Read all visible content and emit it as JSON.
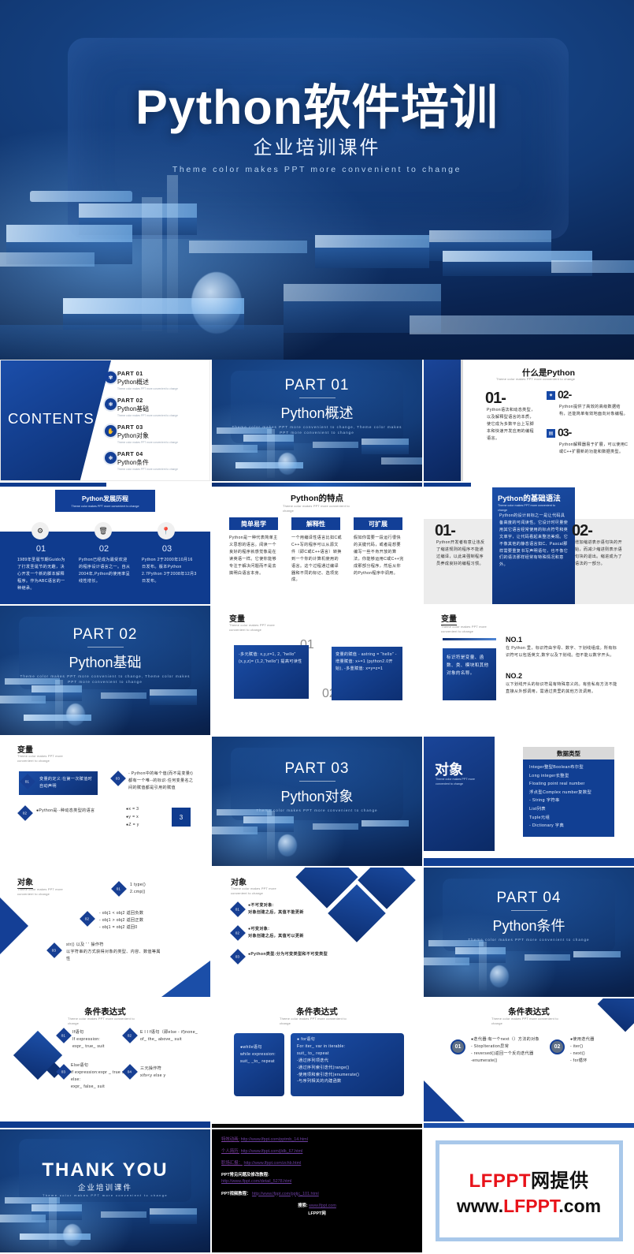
{
  "hero": {
    "title": "Python软件培训",
    "subtitle": "企业培训课件",
    "tagline": "Theme color makes PPT more convenient to change"
  },
  "contents": {
    "heading": "CONTENTS",
    "items": [
      {
        "num": "01",
        "part": "PART 01",
        "name": "Python概述",
        "tag": "Theme color makes PPT more convenient to change",
        "icon": "atom-icon"
      },
      {
        "num": "02",
        "part": "PART 02",
        "name": "Python基础",
        "tag": "Theme color makes PPT more convenient to change",
        "icon": "gear-icon"
      },
      {
        "num": "03",
        "part": "PART 03",
        "name": "Python对象",
        "tag": "Theme color makes PPT more convenient to change",
        "icon": "hand-icon"
      },
      {
        "num": "04",
        "part": "PART 04",
        "name": "Python条件",
        "tag": "Theme color makes PPT more convenient to change",
        "icon": "globe-icon"
      }
    ]
  },
  "sections": [
    {
      "part": "PART 01",
      "name": "Python概述",
      "tag": "Theme color makes PPT more convenient to change, Theme color makes PPT more convenient to change"
    },
    {
      "part": "PART 02",
      "name": "Python基础",
      "tag": "Theme color makes PPT more convenient to change, Theme color makes PPT more convenient to change"
    },
    {
      "part": "PART 03",
      "name": "Python对象",
      "tag": "Theme color makes PPT more convenient to change"
    },
    {
      "part": "PART 04",
      "name": "Python条件",
      "tag": "Theme color makes PPT more convenient to change"
    }
  ],
  "what_is_python": {
    "title": "什么是Python",
    "subtitle": "Theme color makes PPT more convenient to change",
    "items": [
      {
        "num": "01-",
        "text": "Python语法和动态类型，以及解释型语言的本质，使它成为多数平台上写脚本和快速开发应用的编程语言。"
      },
      {
        "num": "02-",
        "text": "Python提供了高效的高级数据结构，还能简单有效地面向对象编程。",
        "icon": "gear-icon"
      },
      {
        "num": "03-",
        "text": "Python解释器易于扩展，可以使用C或C++扩展新的功能和数据类型。",
        "icon": "book-icon"
      }
    ]
  },
  "history": {
    "title": "Python发展历程",
    "subtitle": "Theme color makes PPT more convenient to change",
    "items": [
      {
        "num": "01",
        "icon": "gear-icon",
        "text": "1989年圣诞节期Guido为了打发圣诞节的无趣，决心开发一个新的脚本解释程序。作为ABC语言的一种继承。"
      },
      {
        "num": "02",
        "icon": "trash-icon",
        "text": "Python已经成为最受欢迎的程序设计语言之一。自从2004年,Python的使用率呈线性增长。"
      },
      {
        "num": "03",
        "icon": "pin-icon",
        "text": "Python 2于2000年10月16日发布。版本Python 2.7Python 3于2008年12月3日发布。"
      }
    ]
  },
  "features": {
    "title": "Python的特点",
    "subtitle": "Theme color makes PPT more convenient to change",
    "cards": [
      {
        "head": "简单易学",
        "text": "Python是一种代表简单主义思想的语言。阅读一个良好的程序就感觉像是在读英语一样。它使你能够专注于解决问题而不是去搞明白语言本身。"
      },
      {
        "head": "解释性",
        "text": "一个用编译性语言比如C或C++写的程序可以从源文件（即C或C++语言）转换到一个你的计算机使用的语言。这个过程通过编译器和不同的标记、选项完成。"
      },
      {
        "head": "可扩展",
        "text": "假如你需要一段运行很快的关键代码，或者是想要编写一些不肯开放的算法，你能够运用C或C++完成那部分程序，然后从你的Python程序中调用。"
      }
    ]
  },
  "syntax": {
    "title": "Python的基础语法",
    "subtitle": "Theme color makes PPT more convenient to change",
    "center_text": "Python的设计目标之一是让代码具备高度的可阅读性。它设计时尽量使用其它语言经常使用的标点符号和英文单字，让代码看起来整洁美观。它不像其他的静态语言如C、Pascal那样需要重复书写声明语句，也不像它们的语法那样经常有特殊情况和意外。",
    "left": {
      "num": "01-",
      "text": "Python开发者有意让违反了缩进规则的程序不能通过编译，以此来强制程序员养成良好的编程习惯。"
    },
    "right": {
      "num": "02-",
      "text": "增加缩进表示语句块的开始，而减少缩进则表示语句块的退出。缩进成为了语法的一部分。"
    }
  },
  "variables_1": {
    "title": "变量",
    "subtitle": "Theme color makes PPT more convenient to change",
    "num1": "01",
    "num2": "02",
    "box1": "-多元赋值: x,y,z=1, 2, “hello” (x,y,z)= (1,2,“hello”) 提高可读性",
    "box2": "变量的赋值 - astring = “hello” -增量赋值: x+=1 (python2.0开始), -多重赋值: x=y=z=1"
  },
  "variables_2": {
    "title": "变量",
    "subtitle": "Theme color makes PPT more convenient to change",
    "sidebox": "标识符是变量、函数、类、模块和其他对象的名称。",
    "items": [
      {
        "head": "NO.1",
        "text": "在 Python 里，标识符由字母、数字、下划线组成。所有标识符可以包括英文,数字以及下划线。但不能以数字开头。"
      },
      {
        "head": "NO.2",
        "text": "以下划线开头的标识符是有特殊意义的。有些私有方法不能直接从外部调用，需通过类里的其他方法调用。"
      }
    ]
  },
  "variables_3": {
    "title": "变量",
    "subtitle": "Theme color makes PPT more convenient to change",
    "box1": "变量的定义:在第一次赋值时自动声明",
    "bullets": [
      {
        "num": "01",
        "text": "变量的定义:在第一次赋值时自动声明"
      },
      {
        "num": "02",
        "text": "●Python是·-种动态类型的语言"
      },
      {
        "num": "03",
        "text": "- Python中的每个值(而不是变量t)都有一个唯--的标识·任何变量名之间的赋值都是引用的赋值"
      }
    ],
    "eqs": [
      "●x = 3",
      "●y = x",
      "●Z = y"
    ],
    "result": "3"
  },
  "object_intro": {
    "title": "对象",
    "subtitle": "Theme color makes PPT more convenient to change",
    "table_head": "数据类型",
    "rows": [
      "Integer整型Boolean布尔型",
      "Long integer长整型",
      "Floating point real number",
      "浮点型Complex number复数型",
      "- String 字符串",
      "List列表",
      "Tuple元组",
      "- Dictionary 字典"
    ]
  },
  "object_1": {
    "title": "对象",
    "subtitle": "Theme color makes PPT more convenient to change",
    "items": [
      {
        "num": "01",
        "text": "1 type()\n2.cmp()"
      },
      {
        "num": "02",
        "text": "- obj1 < obj2 返回负数\n- obj1 > obj2 返回正数\n- obj1 = obj2 返回0"
      },
      {
        "num": "03",
        "text": "str() 以及 ' ' 操作符\n以字符串的方式获得对象的类型、内容、数值等属性"
      }
    ]
  },
  "object_2": {
    "title": "对象",
    "subtitle": "Theme color makes PPT more convenient to change",
    "items": [
      {
        "num": "01",
        "text": "●不可变对象:\n对象创建之后，其值不能更新"
      },
      {
        "num": "02",
        "text": "●可变对象:\n对象创建之后，其值可以更新"
      },
      {
        "num": "03",
        "text": "●Python类型:分为可变类型和不可变类型"
      }
    ]
  },
  "cond_1": {
    "title": "条件表达式",
    "subtitle": "Theme color makes PPT more convenient to change",
    "items": [
      {
        "num": "01",
        "text": "If语句\n   If expression:\n  expr_ true_ suit"
      },
      {
        "num": "02",
        "text": "E l l f语句（即else - if)none_ of_ the_ above_ suit"
      },
      {
        "num": "03",
        "text": "Else语句\nif expression:expr _ true suit  else:\nexpr_ false_ suit"
      },
      {
        "num": "04",
        "text": "三元操作符\nxifx<y else y"
      }
    ]
  },
  "cond_2": {
    "title": "条件表达式",
    "subtitle": "Theme color makes PPT more convenient to change",
    "box_left": "●while语句\nwhile expression:\nsuit_ _to_ repeat",
    "box_right": "● for语句\nFor iter_ var in iterable:\nsuit_ to_ repeat\n-通过序列项迭代\n-通过序列索引迭代(range()\n-使用项和索引迭代(enumerate()\n-与序列相关的内建函数"
  },
  "cond_3": {
    "title": "条件表达式",
    "subtitle": "Theme color makes PPT more convenient to change",
    "items": [
      {
        "num": "01",
        "text": "●迭代器:有一个next（）方法的对象\n- StopIteration异常\n- reversed()返回一个反向迭代器\n-enumerate()"
      },
      {
        "num": "02",
        "text": "●使用迭代器\n- iter()\n- next()\n- for循环"
      }
    ]
  },
  "thankyou": {
    "title": "THANK YOU",
    "subtitle": "企业培训课件",
    "tagline": "Theme color makes PPT more convenient to change"
  },
  "links": {
    "rows": [
      {
        "label": "特效动画:",
        "url": "http://www.lfppt.com/pptmb_14.html"
      },
      {
        "label": "个人简历:",
        "url": "http://www.lfppt.com/jldb_67.html"
      },
      {
        "label": "职场汇报：",
        "url": "http://www.lfppt.com/zchb.html"
      }
    ],
    "faq_label": "PPT常见问题及修改教程:",
    "faq_url": "http://www.lfppt.com/detail_5278.html",
    "video_label": "PPT视频教程：",
    "video_url": "http://www.lfppt.com/pptjc_101.html",
    "search_label": "搜索:",
    "search_url": "www.lfppt.com",
    "search_site": "LFPPT网"
  },
  "logo": {
    "line1_red": "LFPPT",
    "line1_black": "网提供",
    "line2_a": "www.",
    "line2_red": "LFPPT",
    "line2_b": ".com"
  },
  "colors": {
    "navy": "#103d91",
    "deep": "#0a2350",
    "accent": "#1b4ea8",
    "red": "#e8131a"
  }
}
